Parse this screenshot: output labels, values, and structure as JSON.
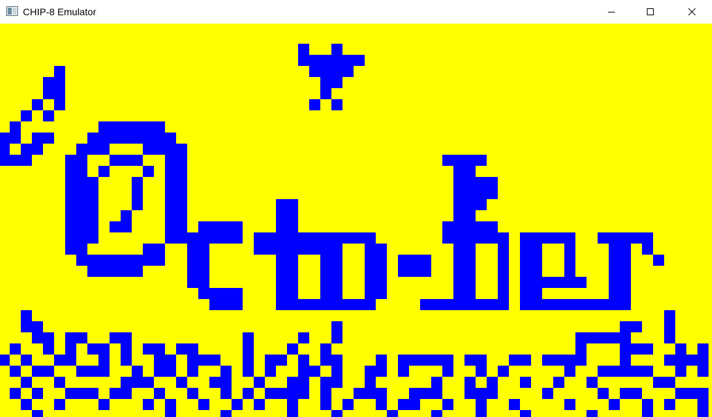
{
  "window": {
    "title": "CHIP-8 Emulator",
    "app_icon": "chip8-app-icon",
    "controls": {
      "minimize_icon": "minimize-icon",
      "maximize_icon": "maximize-icon",
      "close_icon": "close-icon"
    }
  },
  "display": {
    "background_color": "#ffff00",
    "pixel_color": "#0000ff",
    "resolution": "64x32"
  }
}
